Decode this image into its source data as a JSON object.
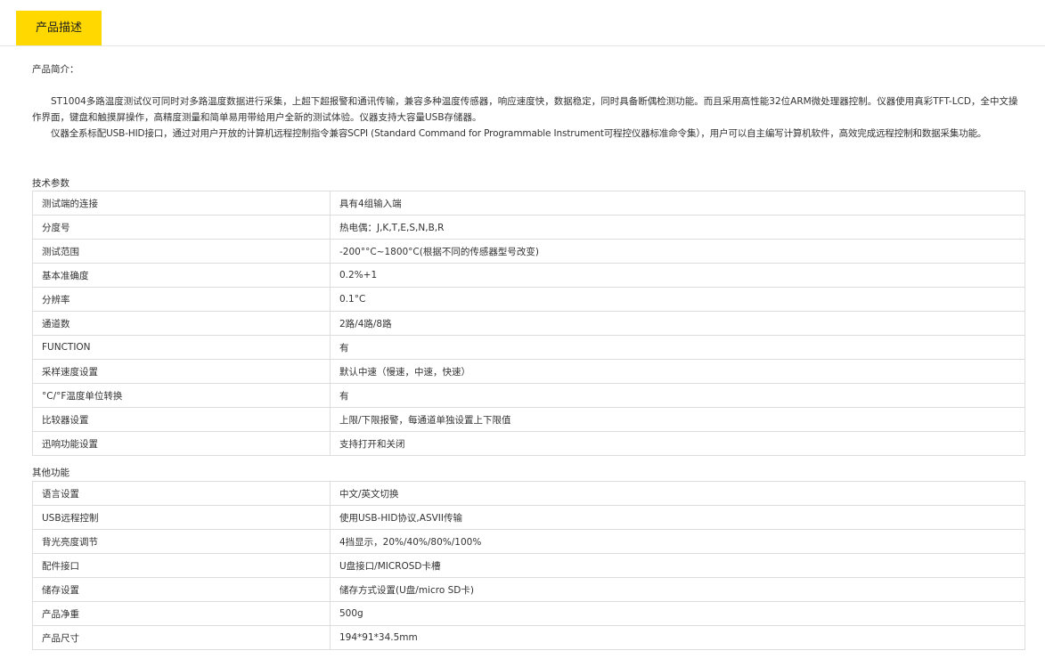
{
  "tabs": {
    "active": "产品描述"
  },
  "intro": {
    "label": "产品简介：",
    "p1": "ST1004多路温度测试仪可同时对多路温度数据进行采集，上超下超报警和通讯传输，兼容多种温度传感器，响应速度快，数据稳定，同时具备断偶检测功能。而且采用高性能32位ARM微处理器控制。仪器使用真彩TFT-LCD，全中文操作界面，键盘和触摸屏操作，高精度测量和简单易用带给用户全新的测试体验。仪器支持大容量USB存储器。",
    "p2": "仪器全系标配USB-HID接口，通过对用户开放的计算机远程控制指令兼容SCPI (Standard Command for Programmable Instrument可程控仪器标准命令集），用户可以自主编写计算机软件，高效完成远程控制和数据采集功能。"
  },
  "tech": {
    "title": "技术参数",
    "rows": [
      {
        "k": "测试端的连接",
        "v": " 具有4组输入端"
      },
      {
        "k": "分度号",
        "v": "热电偶：J,K,T,E,S,N,B,R"
      },
      {
        "k": "测试范围",
        "v": "-200°°C~1800°C(根据不同的传感器型号改变)"
      },
      {
        "k": "基本准确度",
        "v": "0.2%+1"
      },
      {
        "k": "分辨率",
        "v": "0.1°C"
      },
      {
        "k": "通道数",
        "v": "2路/4路/8路"
      },
      {
        "k": "FUNCTION",
        "v": "有"
      },
      {
        "k": "采样速度设置",
        "v": "默认中速（慢速，中速，快速）"
      },
      {
        "k": "°C/°F温度单位转换",
        "v": "有"
      },
      {
        "k": "比较器设置",
        "v": "上限/下限报警，每通道单独设置上下限值"
      },
      {
        "k": "迅响功能设置",
        "v": "支持打开和关闭"
      }
    ]
  },
  "other": {
    "title": "其他功能",
    "rows": [
      {
        "k": "语言设置",
        "v": "中文/英文切换"
      },
      {
        "k": "USB远程控制",
        "v": "使用USB-HID协议,ASVII传输"
      },
      {
        "k": "背光亮度调节",
        "v": "4挡显示，20%/40%/80%/100%"
      },
      {
        "k": "配件接口",
        "v": "U盘接口/MICROSD卡槽"
      },
      {
        "k": "储存设置",
        "v": "储存方式设置(U盘/micro SD卡)"
      },
      {
        "k": "产品净重",
        "v": "500g"
      },
      {
        "k": "产品尺寸",
        "v": "194*91*34.5mm"
      }
    ]
  }
}
